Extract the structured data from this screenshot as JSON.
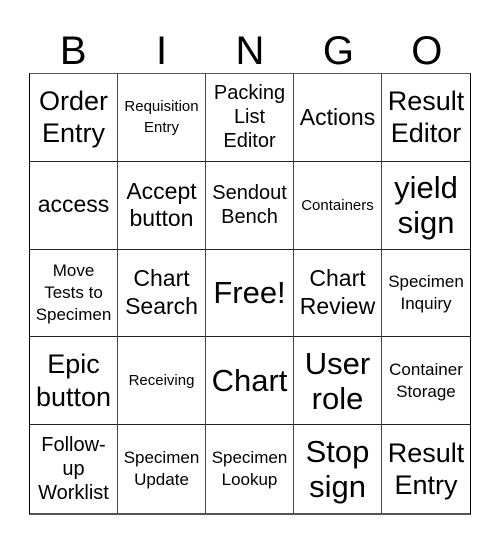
{
  "header": {
    "letters": [
      "B",
      "I",
      "N",
      "G",
      "O"
    ]
  },
  "cells": [
    [
      "Order Entry",
      "Requisition Entry",
      "Packing List Editor",
      "Actions",
      "Result Editor"
    ],
    [
      "access",
      "Accept button",
      "Sendout Bench",
      "Containers",
      "yield sign"
    ],
    [
      "Move Tests to Specimen",
      "Chart Search",
      "Free!",
      "Chart Review",
      "Specimen Inquiry"
    ],
    [
      "Epic button",
      "Receiving",
      "Chart",
      "User role",
      "Container Storage"
    ],
    [
      "Follow-up Worklist",
      "Specimen Update",
      "Specimen Lookup",
      "Stop sign",
      "Result Entry"
    ]
  ],
  "free_space": "Free!"
}
